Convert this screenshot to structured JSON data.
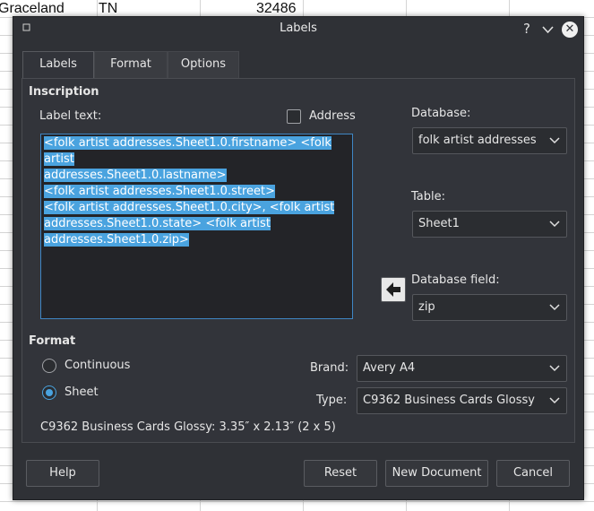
{
  "background": {
    "cells": [
      "Graceland",
      "TN",
      "32486"
    ]
  },
  "dialog": {
    "title": "Labels",
    "help_glyph": "?",
    "tabs": [
      "Labels",
      "Format",
      "Options"
    ],
    "inscription": {
      "heading": "Inscription",
      "label_text": "Label text:",
      "address_label": "Address",
      "address_checked": false,
      "lines": [
        "<folk artist addresses.Sheet1.0.firstname> <folk artist",
        "addresses.Sheet1.0.lastname>",
        "<folk artist addresses.Sheet1.0.street>",
        "<folk artist addresses.Sheet1.0.city>, <folk artist",
        "addresses.Sheet1.0.state> <folk artist",
        "addresses.Sheet1.0.zip>"
      ]
    },
    "database": {
      "label": "Database:",
      "value": "folk artist addresses"
    },
    "table": {
      "label": "Table:",
      "value": "Sheet1"
    },
    "database_field": {
      "label": "Database field:",
      "value": "zip"
    },
    "format": {
      "heading": "Format",
      "continuous": "Continuous",
      "sheet": "Sheet",
      "selected": "Sheet",
      "brand_label": "Brand:",
      "brand_value": "Avery A4",
      "type_label": "Type:",
      "type_value": "C9362 Business Cards Glossy",
      "summary": "C9362 Business Cards Glossy: 3.35″ x 2.13″ (2 x 5)"
    },
    "buttons": {
      "help": "Help",
      "reset": "Reset",
      "new_document": "New Document",
      "cancel": "Cancel"
    },
    "icons": [
      "pin-icon",
      "help-icon",
      "minimize-chevron-icon",
      "close-icon",
      "left-arrow-icon",
      "chevron-down-icon"
    ]
  }
}
